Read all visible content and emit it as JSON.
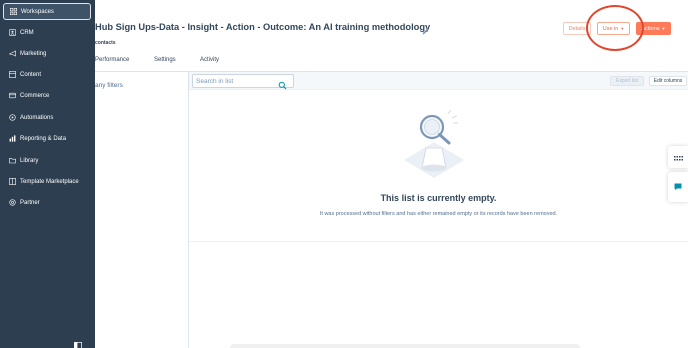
{
  "sidebar": {
    "items": [
      {
        "label": "Workspaces",
        "icon": "workspaces-icon"
      },
      {
        "label": "CRM",
        "icon": "crm-icon"
      },
      {
        "label": "Marketing",
        "icon": "marketing-icon"
      },
      {
        "label": "Content",
        "icon": "content-icon"
      },
      {
        "label": "Commerce",
        "icon": "commerce-icon"
      },
      {
        "label": "Automations",
        "icon": "automations-icon"
      },
      {
        "label": "Reporting & Data",
        "icon": "reporting-icon"
      },
      {
        "label": "Library",
        "icon": "library-icon"
      },
      {
        "label": "Template Marketplace",
        "icon": "template-marketplace-icon"
      },
      {
        "label": "Partner",
        "icon": "partner-icon"
      }
    ],
    "active_item": "Workspaces"
  },
  "header": {
    "title": "Hub Sign Ups-Data - Insight - Action - Outcome: An AI training methodology",
    "subtitle": "contacts",
    "details_label": "Details",
    "use_in_label": "Use in",
    "actions_label": "Actions"
  },
  "tabs": [
    {
      "label": "Performance"
    },
    {
      "label": "Settings"
    },
    {
      "label": "Activity"
    }
  ],
  "filters": {
    "text": "any filters"
  },
  "toolbar": {
    "search_placeholder": "Search in list",
    "export_label": "Export list",
    "edit_columns_label": "Edit columns"
  },
  "empty_state": {
    "title": "This list is currently empty.",
    "description": "It was processed without filters and has either remained empty or its records have been removed."
  },
  "colors": {
    "sidebar_bg": "#2d3e50",
    "accent": "#ff7a59",
    "annotation": "#e0472f"
  }
}
